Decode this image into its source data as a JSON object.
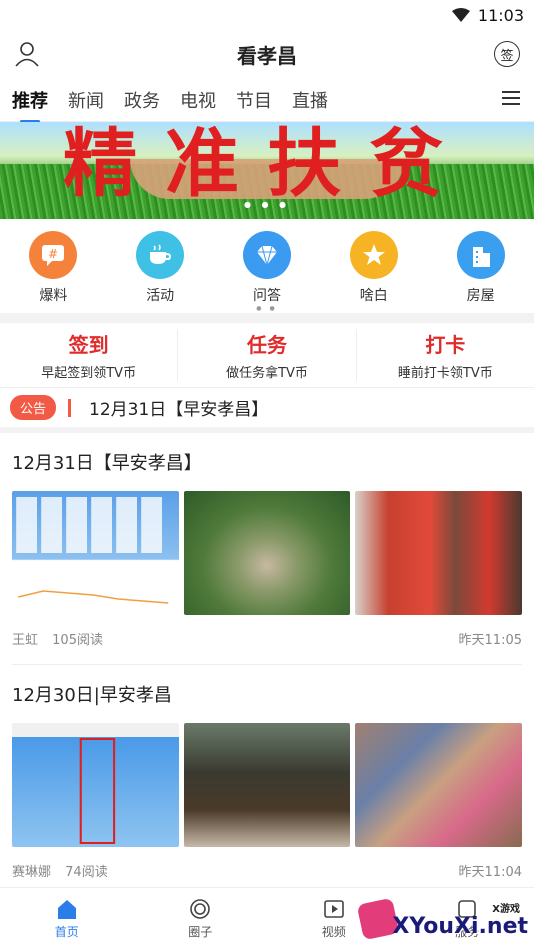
{
  "status": {
    "time": "11:03"
  },
  "header": {
    "title": "看孝昌",
    "sign_label": "签"
  },
  "tabs": [
    {
      "label": "推荐",
      "active": true
    },
    {
      "label": "新闻"
    },
    {
      "label": "政务"
    },
    {
      "label": "电视"
    },
    {
      "label": "节目"
    },
    {
      "label": "直播"
    }
  ],
  "banner": {
    "slogan": "精准扶贫"
  },
  "quick_actions": [
    {
      "label": "爆料",
      "icon": "hash-icon",
      "color": "#f5823a"
    },
    {
      "label": "活动",
      "icon": "cup-icon",
      "color": "#3fc1e6"
    },
    {
      "label": "问答",
      "icon": "diamond-icon",
      "color": "#3a9bf0"
    },
    {
      "label": "啥白",
      "icon": "star-icon",
      "color": "#f6b424"
    },
    {
      "label": "房屋",
      "icon": "building-icon",
      "color": "#3b9ff0"
    }
  ],
  "tasks": [
    {
      "title": "签到",
      "desc": "早起签到领TV币"
    },
    {
      "title": "任务",
      "desc": "做任务拿TV币"
    },
    {
      "title": "打卡",
      "desc": "睡前打卡领TV币"
    }
  ],
  "notice": {
    "badge": "公告",
    "text": "12月31日【早安孝昌】"
  },
  "articles": [
    {
      "title": "12月31日【早安孝昌】",
      "author": "王虹",
      "reads": "105阅读",
      "time": "昨天11:05"
    },
    {
      "title": "12月30日|早安孝昌",
      "author": "赛琳娜",
      "reads": "74阅读",
      "time": "昨天11:04"
    }
  ],
  "bottom_nav": [
    {
      "label": "首页",
      "icon": "home-icon",
      "active": true
    },
    {
      "label": "圈子",
      "icon": "circle-icon"
    },
    {
      "label": "视频",
      "icon": "video-icon"
    },
    {
      "label": "服务",
      "icon": "service-icon"
    }
  ],
  "watermark": {
    "text": "XYouXi.net",
    "small": "X游戏"
  }
}
